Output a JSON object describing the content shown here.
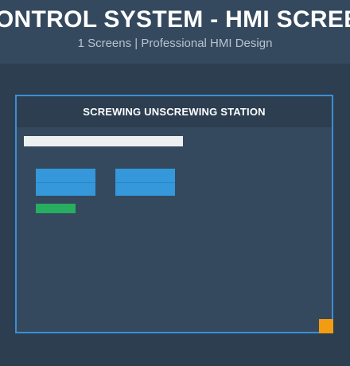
{
  "header": {
    "title": "L CONTROL SYSTEM - HMI SCREENS",
    "subtitle": "1 Screens | Professional HMI Design"
  },
  "screen": {
    "title": "SCREWING UNSCREWING STATION"
  },
  "colors": {
    "background": "#2c3e50",
    "panel": "#34495e",
    "border": "#3b8fd6",
    "button": "#3498db",
    "status": "#27ae60",
    "marker": "#f39c12",
    "bar": "#ecf0f1"
  }
}
